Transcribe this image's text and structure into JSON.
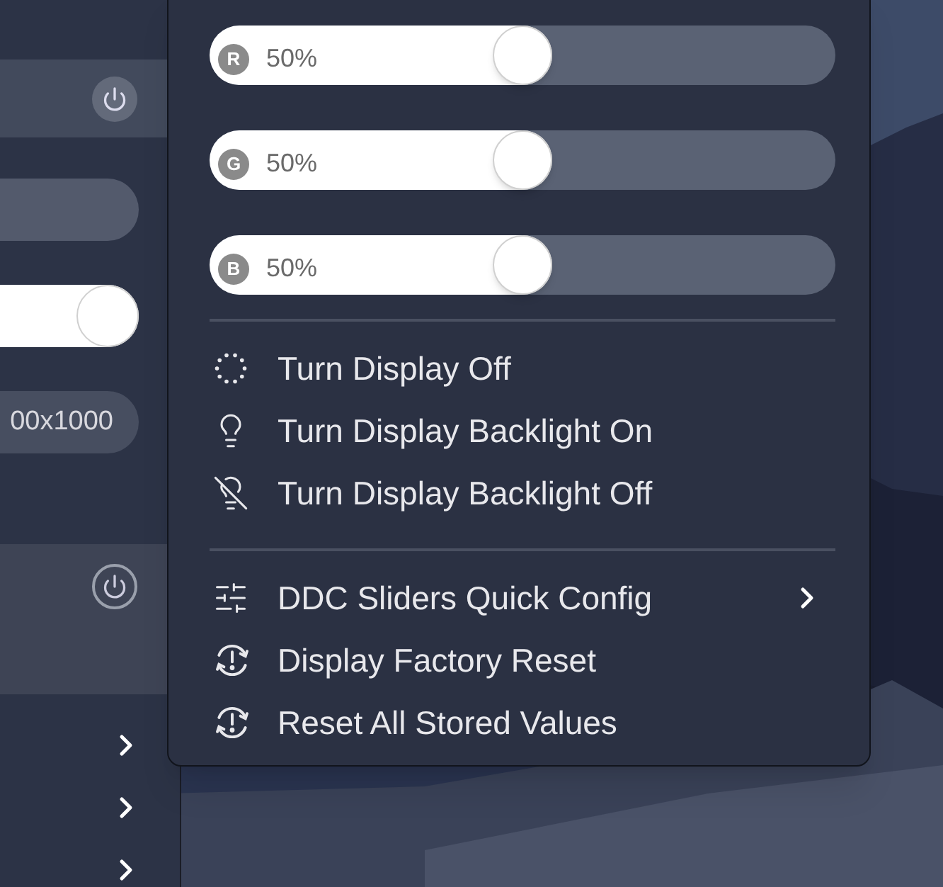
{
  "background_menu": {
    "sliders": [
      {
        "level": 1
      }
    ],
    "resolution_field": {
      "value": "00x1000"
    }
  },
  "submenu": {
    "color_sliders": [
      {
        "channel": "R",
        "reading": "50%",
        "level": 0.5
      },
      {
        "channel": "G",
        "reading": "50%",
        "level": 0.5
      },
      {
        "channel": "B",
        "reading": "50%",
        "level": 0.5
      }
    ],
    "sections": [
      [
        {
          "label": "Turn Display Off",
          "kind": "action"
        },
        {
          "label": "Turn Display Backlight On",
          "kind": "action"
        },
        {
          "label": "Turn Display Backlight Off",
          "kind": "action"
        }
      ],
      [
        {
          "label": "DDC Sliders Quick Config",
          "kind": "submenu"
        },
        {
          "label": "Display Factory Reset",
          "kind": "action"
        },
        {
          "label": "Reset All Stored Values",
          "kind": "action"
        }
      ]
    ]
  }
}
